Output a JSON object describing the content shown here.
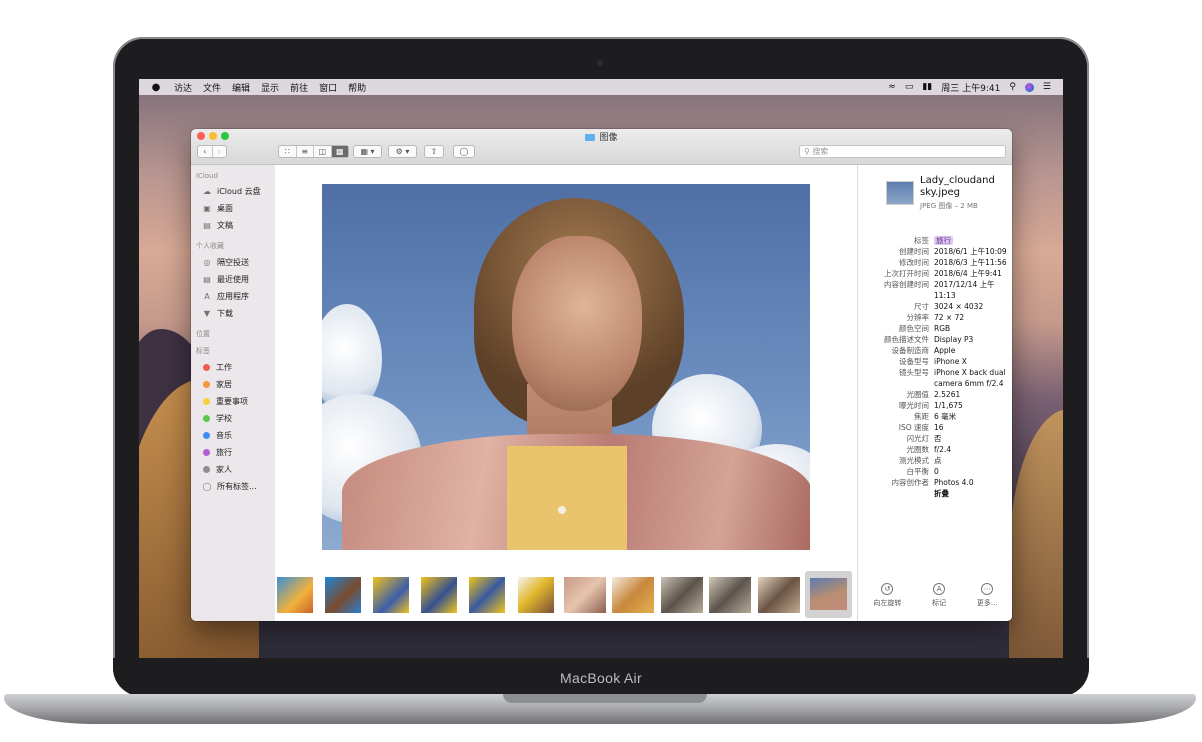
{
  "device": {
    "brand_label": "MacBook Air"
  },
  "menubar": {
    "apple_icon": "apple-icon",
    "items": [
      "访达",
      "文件",
      "编辑",
      "显示",
      "前往",
      "窗口",
      "帮助"
    ],
    "clock": "周三 上午9:41"
  },
  "window": {
    "title": "图像",
    "search_placeholder": "搜索",
    "traffic_colors": {
      "close": "#fe5f57",
      "minimize": "#febc2e",
      "zoom": "#28c840"
    }
  },
  "sidebar": {
    "icloud_header": "iCloud",
    "icloud_items": [
      {
        "label": "iCloud 云盘",
        "icon": "cloud-icon"
      },
      {
        "label": "桌面",
        "icon": "desktop-icon"
      },
      {
        "label": "文稿",
        "icon": "document-icon"
      }
    ],
    "favorites_header": "个人收藏",
    "favorites_items": [
      {
        "label": "隔空投送",
        "icon": "airdrop-icon"
      },
      {
        "label": "最近使用",
        "icon": "recents-icon"
      },
      {
        "label": "应用程序",
        "icon": "applications-icon"
      },
      {
        "label": "下载",
        "icon": "download-icon"
      }
    ],
    "locations_header": "位置",
    "tags_header": "标签",
    "tags": [
      {
        "label": "工作",
        "color": "#f25b55"
      },
      {
        "label": "家居",
        "color": "#f5963a"
      },
      {
        "label": "重要事项",
        "color": "#f7d03b"
      },
      {
        "label": "学校",
        "color": "#5bc84a"
      },
      {
        "label": "音乐",
        "color": "#3b8df4"
      },
      {
        "label": "旅行",
        "color": "#b25fd6"
      },
      {
        "label": "家人",
        "color": "#8e8e93"
      }
    ],
    "all_tags": "所有标签..."
  },
  "inspector": {
    "filename": "Lady_cloudand sky.jpeg",
    "subtitle": "JPEG 图像 – 2 MB",
    "metadata": [
      {
        "key": "标签",
        "value": "旅行"
      },
      {
        "key": "创建时间",
        "value": "2018/6/1 上午10:09"
      },
      {
        "key": "修改时间",
        "value": "2018/6/3 上午11:56"
      },
      {
        "key": "上次打开时间",
        "value": "2018/6/4 上午9:41"
      },
      {
        "key": "内容创建时间",
        "value": "2017/12/14 上午11:13"
      },
      {
        "key": "尺寸",
        "value": "3024 × 4032"
      },
      {
        "key": "分辨率",
        "value": "72 × 72"
      },
      {
        "key": "颜色空间",
        "value": "RGB"
      },
      {
        "key": "颜色描述文件",
        "value": "Display P3"
      },
      {
        "key": "设备制造商",
        "value": "Apple"
      },
      {
        "key": "设备型号",
        "value": "iPhone X"
      },
      {
        "key": "镜头型号",
        "value": "iPhone X back dual camera 6mm f/2.4"
      },
      {
        "key": "光圈值",
        "value": "2.5261"
      },
      {
        "key": "曝光时间",
        "value": "1/1,675"
      },
      {
        "key": "焦距",
        "value": "6 毫米"
      },
      {
        "key": "ISO 速度",
        "value": "16"
      },
      {
        "key": "闪光灯",
        "value": "否"
      },
      {
        "key": "光圈数",
        "value": "f/2.4"
      },
      {
        "key": "测光模式",
        "value": "点"
      },
      {
        "key": "白平衡",
        "value": "0"
      },
      {
        "key": "内容创作者",
        "value": "Photos 4.0"
      }
    ],
    "collapse_label": "折叠",
    "actions": [
      {
        "label": "向左旋转",
        "icon": "rotate-left-icon"
      },
      {
        "label": "标记",
        "icon": "markup-icon"
      },
      {
        "label": "更多...",
        "icon": "more-icon"
      }
    ]
  }
}
